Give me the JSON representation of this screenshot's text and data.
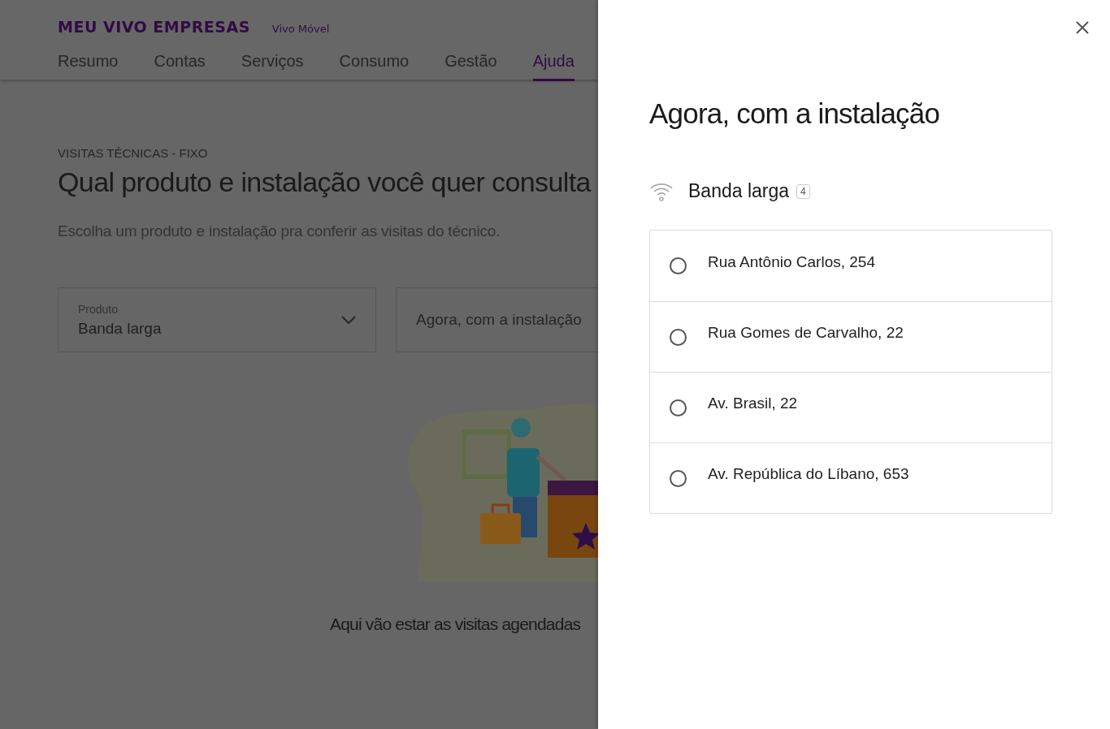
{
  "header": {
    "logo": "MEU VIVO EMPRESAS",
    "account": "Vivo Móvel"
  },
  "nav": [
    {
      "label": "Resumo",
      "selected": false
    },
    {
      "label": "Contas",
      "selected": false
    },
    {
      "label": "Serviços",
      "selected": false
    },
    {
      "label": "Consumo",
      "selected": false
    },
    {
      "label": "Gestão",
      "selected": false
    },
    {
      "label": "Ajuda",
      "selected": true
    }
  ],
  "page": {
    "eyebrow": "VISITAS TÉCNICAS - FIXO",
    "title": "Qual produto e instalação você quer consulta",
    "subtitle": "Escolha um produto e instalação pra conferir as visitas do técnico.",
    "product_select": {
      "label": "Produto",
      "value": "Banda larga"
    },
    "installation_select": {
      "placeholder": "Agora, com a instalação"
    },
    "empty_message": "Aqui vão estar as visitas agendadas"
  },
  "drawer": {
    "title": "Agora, com a instalação",
    "product": "Banda larga",
    "count": "4",
    "options": [
      {
        "label": "Rua Antônio Carlos, 254",
        "selected": false
      },
      {
        "label": "Rua Gomes de Carvalho, 22",
        "selected": false
      },
      {
        "label": "Av. Brasil, 22",
        "selected": false
      },
      {
        "label": "Av. República do Líbano, 653",
        "selected": false
      }
    ]
  }
}
